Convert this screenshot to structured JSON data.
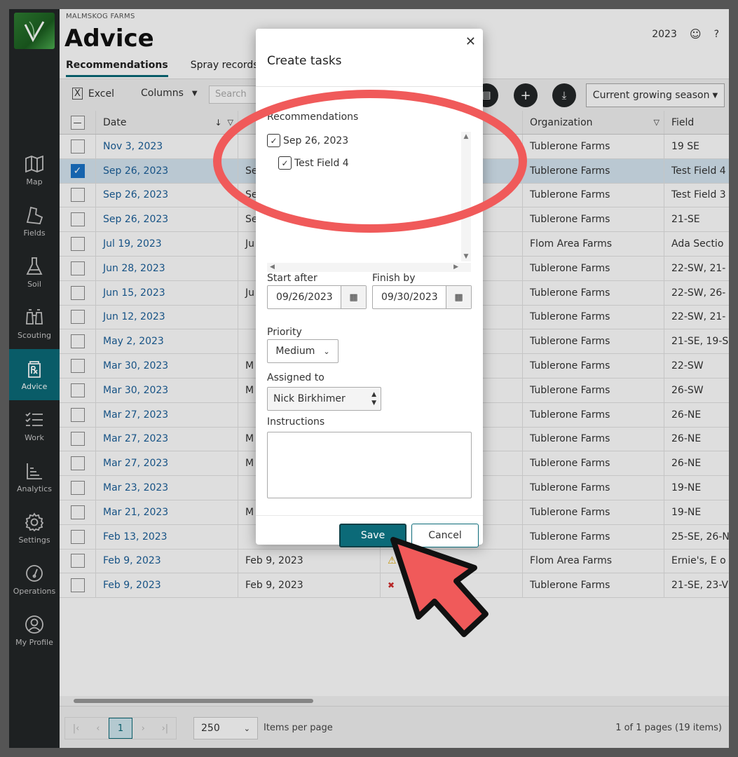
{
  "header": {
    "org": "MALMSKOG FARMS",
    "title": "Advice",
    "year": "2023",
    "help": "?",
    "tabs": [
      "Recommendations",
      "Spray records"
    ]
  },
  "sidebar": {
    "items": [
      {
        "label": "Map",
        "icon": "map-icon"
      },
      {
        "label": "Fields",
        "icon": "fields-icon"
      },
      {
        "label": "Soil",
        "icon": "flask-icon"
      },
      {
        "label": "Scouting",
        "icon": "binoculars-icon"
      },
      {
        "label": "Advice",
        "icon": "prescription-icon"
      },
      {
        "label": "Work",
        "icon": "checklist-icon"
      },
      {
        "label": "Analytics",
        "icon": "chart-icon"
      },
      {
        "label": "Settings",
        "icon": "gear-icon"
      },
      {
        "label": "Operations",
        "icon": "gauge-icon"
      },
      {
        "label": "My Profile",
        "icon": "user-icon"
      }
    ]
  },
  "toolbar": {
    "excel": "Excel",
    "columns": "Columns",
    "search_placeholder": "Search",
    "season": "Current growing season"
  },
  "grid": {
    "headers": {
      "date": "Date",
      "organization": "Organization",
      "field": "Field"
    },
    "rows": [
      {
        "date": "Nov 3, 2023",
        "start": "",
        "org": "Tublerone Farms",
        "field": "19 SE"
      },
      {
        "date": "Sep 26, 2023",
        "start": "Se",
        "org": "Tublerone Farms",
        "field": "Test Field 4"
      },
      {
        "date": "Sep 26, 2023",
        "start": "Se",
        "org": "Tublerone Farms",
        "field": "Test Field 3"
      },
      {
        "date": "Sep 26, 2023",
        "start": "Se",
        "org": "Tublerone Farms",
        "field": "21-SE"
      },
      {
        "date": "Jul 19, 2023",
        "start": "Ju",
        "org": "Flom Area Farms",
        "field": "Ada Sectio"
      },
      {
        "date": "Jun 28, 2023",
        "start": "",
        "org": "Tublerone Farms",
        "field": "22-SW, 21-"
      },
      {
        "date": "Jun 15, 2023",
        "start": "Ju",
        "org": "Tublerone Farms",
        "field": "22-SW, 26-"
      },
      {
        "date": "Jun 12, 2023",
        "start": "",
        "org": "Tublerone Farms",
        "field": "22-SW, 21-"
      },
      {
        "date": "May 2, 2023",
        "start": "",
        "org": "Tublerone Farms",
        "field": "21-SE, 19-S"
      },
      {
        "date": "Mar 30, 2023",
        "start": "M",
        "org": "Tublerone Farms",
        "field": "22-SW"
      },
      {
        "date": "Mar 30, 2023",
        "start": "M",
        "org": "Tublerone Farms",
        "field": "26-SW"
      },
      {
        "date": "Mar 27, 2023",
        "start": "",
        "org": "Tublerone Farms",
        "field": "26-NE"
      },
      {
        "date": "Mar 27, 2023",
        "start": "M",
        "org": "Tublerone Farms",
        "field": "26-NE"
      },
      {
        "date": "Mar 27, 2023",
        "start": "M",
        "org": "Tublerone Farms",
        "field": "26-NE"
      },
      {
        "date": "Mar 23, 2023",
        "start": "",
        "org": "Tublerone Farms",
        "field": "19-NE"
      },
      {
        "date": "Mar 21, 2023",
        "start": "M",
        "org": "Tublerone Farms",
        "field": "19-NE"
      },
      {
        "date": "Feb 13, 2023",
        "start": "",
        "org": "Tublerone Farms",
        "field": "25-SE, 26-N"
      },
      {
        "date": "Feb 9, 2023",
        "start": "Feb 9, 2023",
        "org": "Flom Area Farms",
        "field": "Ernie's, E o"
      },
      {
        "date": "Feb 9, 2023",
        "start": "Feb 9, 2023",
        "org": "Tublerone Farms",
        "field": "21-SE, 23-V"
      }
    ],
    "selected_index": 1
  },
  "footer": {
    "page": "1",
    "page_size": "250",
    "items_per_page": "Items per page",
    "page_info": "1 of 1 pages (19 items)"
  },
  "dialog": {
    "title": "Create tasks",
    "recommendations_label": "Recommendations",
    "tree_parent": "Sep 26, 2023",
    "tree_child": "Test Field 4",
    "start_after_label": "Start after",
    "start_after": "09/26/2023",
    "finish_by_label": "Finish by",
    "finish_by": "09/30/2023",
    "priority_label": "Priority",
    "priority": "Medium",
    "assigned_label": "Assigned to",
    "assigned": "Nick Birkhimer",
    "instructions_label": "Instructions",
    "save": "Save",
    "cancel": "Cancel"
  },
  "colors": {
    "accent": "#0b6a78",
    "annotation": "#f05a5a",
    "sidebar": "#232628"
  }
}
